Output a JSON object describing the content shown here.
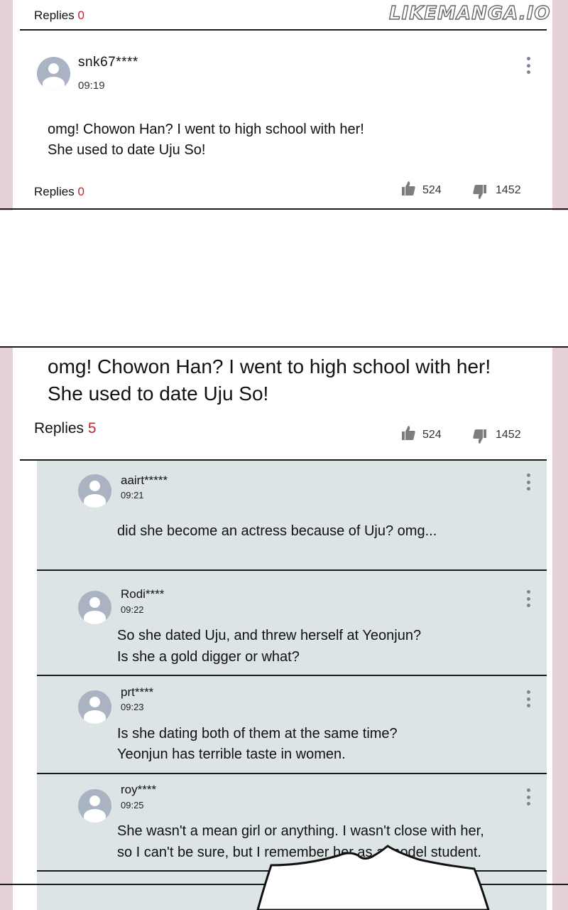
{
  "watermark": "LIKEMANGA.IO",
  "top_panel": {
    "header_replies_label": "Replies",
    "header_replies_count": "0",
    "comment": {
      "username": "snk67****",
      "time": "09:19",
      "lines": [
        "omg! Chowon Han? I went to high school with her!",
        "She used to date Uju So!"
      ],
      "replies_label": "Replies",
      "replies_count": "0",
      "likes": "524",
      "dislikes": "1452"
    }
  },
  "bottom_panel": {
    "comment_lines": [
      "omg! Chowon Han? I went to high school with her!",
      "She used to date Uju So!"
    ],
    "replies_label": "Replies",
    "replies_count": "5",
    "likes": "524",
    "dislikes": "1452",
    "replies": [
      {
        "username": "aairt*****",
        "time": "09:21",
        "lines": [
          "did she become an actress because of Uju? omg..."
        ]
      },
      {
        "username": "Rodi****",
        "time": "09:22",
        "lines": [
          "So she dated Uju, and threw herself at Yeonjun?",
          "Is she a gold digger or what?"
        ]
      },
      {
        "username": "prt****",
        "time": "09:23",
        "lines": [
          "Is she dating both of them at the same time?",
          "Yeonjun has terrible taste in women."
        ]
      },
      {
        "username": "roy****",
        "time": "09:25",
        "lines": [
          "She wasn't a mean girl or anything. I wasn't close with her,",
          "so I can't be sure, but I remember her as a model student."
        ]
      }
    ]
  },
  "icons": {
    "avatar": "user-avatar-icon",
    "menu": "kebab-menu-icon",
    "like": "thumbs-up-icon",
    "dislike": "thumbs-down-icon"
  },
  "colors": {
    "panel_border": "#e4d2d8",
    "reply_background": "#dde4e6",
    "reply_count": "#c0272d",
    "avatar": "#a9b3c1"
  }
}
